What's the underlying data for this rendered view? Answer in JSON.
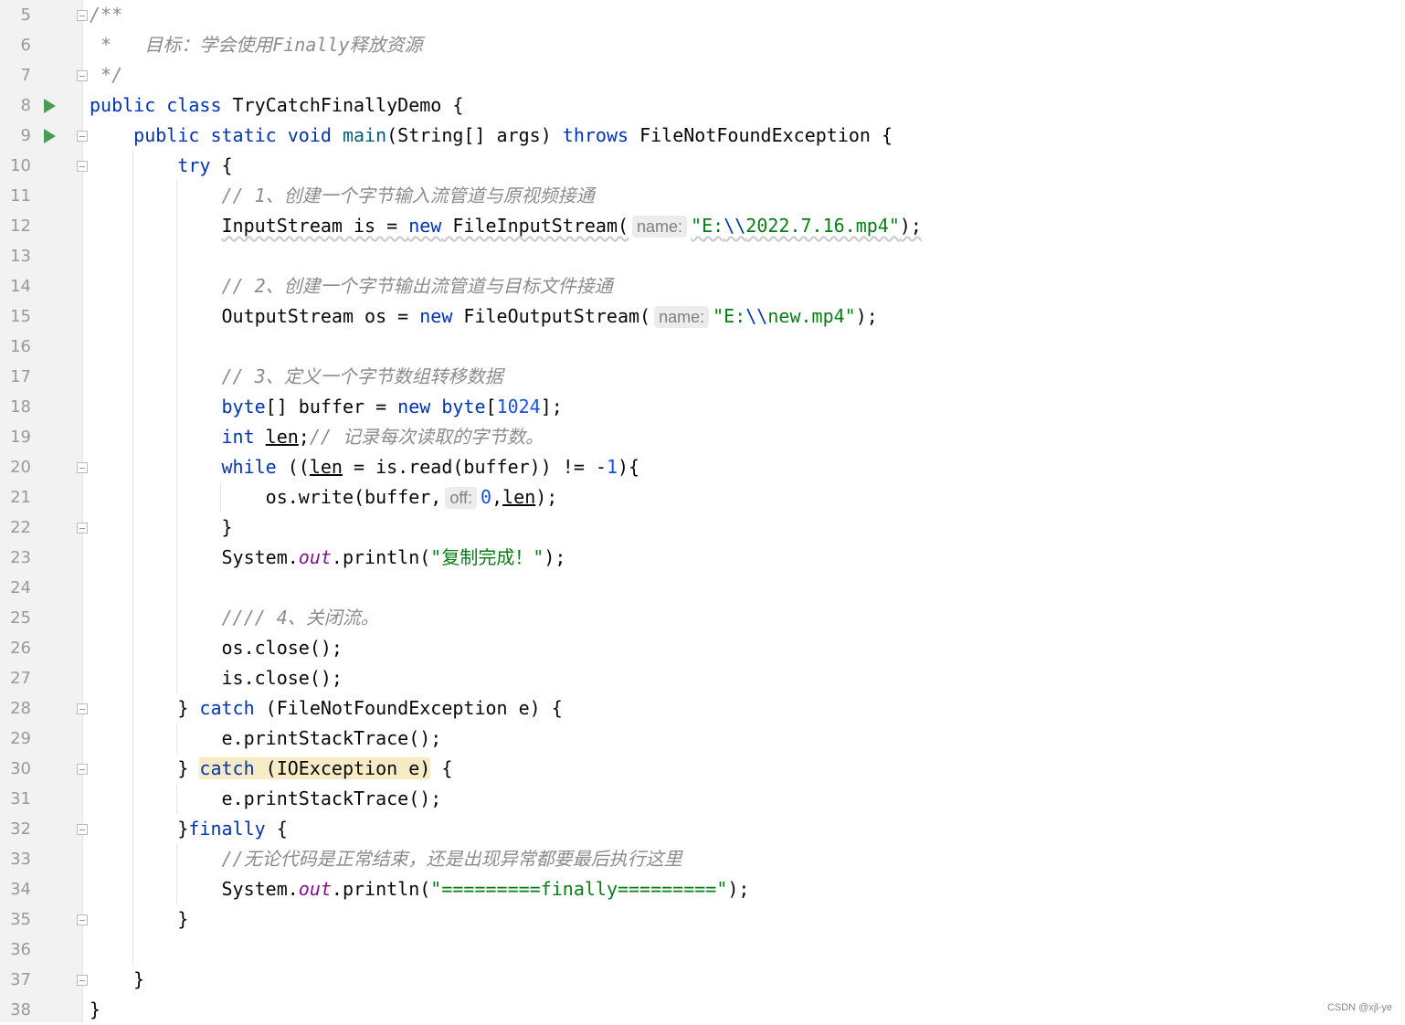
{
  "editor": {
    "first_line_number": 5,
    "run_lines": [
      8,
      9
    ],
    "fold_lines": [
      5,
      7,
      9,
      10,
      20,
      22,
      28,
      30,
      32,
      35,
      37
    ],
    "colors": {
      "keyword": "#0033b3",
      "comment": "#8c8c8c",
      "string": "#067d17",
      "number": "#1750eb",
      "static_field": "#871094",
      "highlight": "#f6ebc5"
    },
    "lines": [
      [
        [
          "cm",
          "/**"
        ]
      ],
      [
        [
          "cm",
          " *   目标：学会使用Finally释放资源"
        ]
      ],
      [
        [
          "cm",
          " */"
        ]
      ],
      [
        [
          "kw",
          "public"
        ],
        [
          "",
          ""
        ],
        [
          "",
          " "
        ],
        [
          "kw",
          "class"
        ],
        [
          "",
          " TryCatchFinallyDemo {"
        ]
      ],
      [
        [
          "",
          "    "
        ],
        [
          "kw",
          "public static void"
        ],
        [
          "",
          " "
        ],
        [
          "fn",
          "main"
        ],
        [
          "",
          "(String[] args) "
        ],
        [
          "kw",
          "throws"
        ],
        [
          "",
          " FileNotFoundException {"
        ]
      ],
      [
        [
          "",
          "        "
        ],
        [
          "kw",
          "try"
        ],
        [
          "",
          " {"
        ]
      ],
      [
        [
          "",
          "            "
        ],
        [
          "cm",
          "// 1、创建一个字节输入流管道与原视频接通"
        ]
      ],
      [
        [
          "",
          "            "
        ],
        [
          "wavy",
          "InputStream is = "
        ],
        [
          "wavy kw",
          "new"
        ],
        [
          "wavy",
          " FileInputStream("
        ],
        [
          "hint",
          "name:"
        ],
        [
          "wavy str",
          "\"E:"
        ],
        [
          "wavy esc",
          "\\\\"
        ],
        [
          "wavy str",
          "2022.7.16.mp4\""
        ],
        [
          "wavy",
          ");"
        ]
      ],
      [],
      [
        [
          "",
          "            "
        ],
        [
          "cm",
          "// 2、创建一个字节输出流管道与目标文件接通"
        ]
      ],
      [
        [
          "",
          "            OutputStream os = "
        ],
        [
          "kw",
          "new"
        ],
        [
          "",
          " FileOutputStream("
        ],
        [
          "hint",
          "name:"
        ],
        [
          "str",
          "\"E:"
        ],
        [
          "esc",
          "\\\\"
        ],
        [
          "str",
          "new.mp4\""
        ],
        [
          "",
          ");"
        ]
      ],
      [],
      [
        [
          "",
          "            "
        ],
        [
          "cm",
          "// 3、定义一个字节数组转移数据"
        ]
      ],
      [
        [
          "",
          "            "
        ],
        [
          "kw",
          "byte"
        ],
        [
          "",
          "[] buffer = "
        ],
        [
          "kw",
          "new"
        ],
        [
          "",
          " "
        ],
        [
          "kw",
          "byte"
        ],
        [
          "",
          "["
        ],
        [
          "num",
          "1024"
        ],
        [
          "",
          "];"
        ]
      ],
      [
        [
          "",
          "            "
        ],
        [
          "kw",
          "int"
        ],
        [
          "",
          " "
        ],
        [
          "ul",
          "len"
        ],
        [
          "",
          ";"
        ],
        [
          "cm",
          "// 记录每次读取的字节数。"
        ]
      ],
      [
        [
          "",
          "            "
        ],
        [
          "kw",
          "while"
        ],
        [
          "",
          " (("
        ],
        [
          "ul",
          "len"
        ],
        [
          "",
          " = is.read(buffer)) != -"
        ],
        [
          "num",
          "1"
        ],
        [
          "",
          "){"
        ]
      ],
      [
        [
          "",
          "                os.write(buffer,"
        ],
        [
          "hint",
          "off:"
        ],
        [
          "num",
          "0"
        ],
        [
          "",
          ","
        ],
        [
          "ul",
          "len"
        ],
        [
          "",
          ");"
        ]
      ],
      [
        [
          "",
          "            }"
        ]
      ],
      [
        [
          "",
          "            System."
        ],
        [
          "st",
          "out"
        ],
        [
          "",
          ".println("
        ],
        [
          "str",
          "\"复制完成！\""
        ],
        [
          "",
          ");"
        ]
      ],
      [],
      [
        [
          "",
          "            "
        ],
        [
          "cm",
          "//// 4、关闭流。"
        ]
      ],
      [
        [
          "",
          "            os.close();"
        ]
      ],
      [
        [
          "",
          "            is.close();"
        ]
      ],
      [
        [
          "",
          "        } "
        ],
        [
          "kw",
          "catch"
        ],
        [
          "",
          " (FileNotFoundException e) {"
        ]
      ],
      [
        [
          "",
          "            e.printStackTrace();"
        ]
      ],
      [
        [
          "",
          "        } "
        ],
        [
          "kw hl",
          "catch"
        ],
        [
          "hl",
          " (IOException e)"
        ],
        [
          "",
          " {"
        ]
      ],
      [
        [
          "",
          "            e.printStackTrace();"
        ]
      ],
      [
        [
          "",
          "        }"
        ],
        [
          "kw",
          "finally"
        ],
        [
          "",
          " {"
        ]
      ],
      [
        [
          "",
          "            "
        ],
        [
          "cm",
          "//无论代码是正常结束，还是出现异常都要最后执行这里"
        ]
      ],
      [
        [
          "",
          "            System."
        ],
        [
          "st",
          "out"
        ],
        [
          "",
          ".println("
        ],
        [
          "str",
          "\"=========finally=========\""
        ],
        [
          "",
          ");"
        ]
      ],
      [
        [
          "",
          "        }"
        ]
      ],
      [],
      [
        [
          "",
          "    }"
        ]
      ],
      [
        [
          "",
          "}"
        ]
      ]
    ]
  },
  "watermark": "CSDN @xjl-ye"
}
